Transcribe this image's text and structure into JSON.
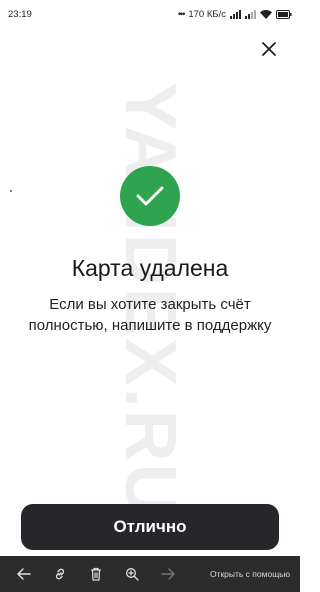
{
  "status_bar": {
    "time": "23:19",
    "network_speed": "170 КБ/с",
    "icons": [
      "overflow-dots-icon",
      "signal-icon",
      "signal-icon",
      "wifi-icon",
      "battery-icon"
    ]
  },
  "watermark": "YANDEX.RU",
  "dialog": {
    "close_icon": "close-icon",
    "success_icon": "check-circle-icon",
    "success_color": "#2ea44f",
    "title": "Карта удалена",
    "message": "Если вы хотите закрыть счёт полностью, напишите в поддержку",
    "primary_button": "Отлично",
    "button_color": "#26262b"
  },
  "toolbar": {
    "icons": [
      "back-arrow-icon",
      "link-icon",
      "trash-icon",
      "zoom-in-icon",
      "forward-arrow-icon"
    ],
    "open_with": "Открыть с помощью"
  }
}
